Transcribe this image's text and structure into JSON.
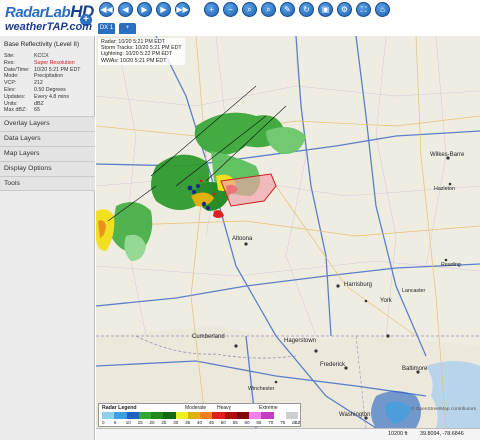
{
  "logo": {
    "line1": "RadarLab",
    "line1_hd": "HD",
    "plus": "+",
    "line2": "weatherTAP.com"
  },
  "toolbar": {
    "buttons": [
      {
        "icon": "skip-back-icon",
        "glyph": "◀◀"
      },
      {
        "icon": "step-back-icon",
        "glyph": "◀"
      },
      {
        "icon": "play-icon",
        "glyph": "▶"
      },
      {
        "icon": "step-forward-icon",
        "glyph": "▶"
      },
      {
        "icon": "skip-forward-icon",
        "glyph": "▶▶"
      },
      {
        "icon": "zoom-in-icon",
        "glyph": "+"
      },
      {
        "icon": "zoom-out-icon",
        "glyph": "−"
      },
      {
        "icon": "zoom-tool-icon",
        "glyph": "⌕"
      },
      {
        "icon": "zoom-reset-icon",
        "glyph": "⌕"
      },
      {
        "icon": "edit-icon",
        "glyph": "✎"
      },
      {
        "icon": "refresh-icon",
        "glyph": "↻"
      },
      {
        "icon": "save-icon",
        "glyph": "▣"
      },
      {
        "icon": "settings-icon",
        "glyph": "⚙"
      },
      {
        "icon": "fullscreen-icon",
        "glyph": "⛶"
      },
      {
        "icon": "home-icon",
        "glyph": "⌂"
      }
    ],
    "tabs": [
      {
        "label": "DX 1"
      },
      {
        "label": "+"
      }
    ]
  },
  "sidebar": {
    "title": "Base Reflectivity (Level II)",
    "info": [
      {
        "key": "Site:",
        "value": "KCCX"
      },
      {
        "key": "Res:",
        "value": "Super Resolution",
        "highlight": "#c81e1e"
      },
      {
        "key": "Date/Time:",
        "value": "10/20 5:21 PM EDT"
      },
      {
        "key": "Mode:",
        "value": "Precipitation"
      },
      {
        "key": "VCP:",
        "value": "212"
      },
      {
        "key": "Elev:",
        "value": "0.50 Degrees"
      },
      {
        "key": "Updates:",
        "value": "Every 4.8 mins"
      },
      {
        "key": "Units:",
        "value": "dBZ"
      },
      {
        "key": "Max dBZ:",
        "value": "65"
      }
    ],
    "menu": [
      "Overlay Layers",
      "Data Layers",
      "Map Layers",
      "Display Options",
      "Tools"
    ]
  },
  "map": {
    "overlay_info": [
      "Radar: 10/20 5:21 PM EDT",
      "Storm Tracks: 10/20 5:21 PM EDT",
      "Lightning: 10/20 5:22 PM EDT",
      "WWAs: 10/20 5:21 PM EDT"
    ],
    "cities": [
      {
        "name": "Wilkes-Barre",
        "big": true
      },
      {
        "name": "Hazleton",
        "big": false
      },
      {
        "name": "Altoona",
        "big": true
      },
      {
        "name": "Harrisburg",
        "big": true
      },
      {
        "name": "Reading",
        "big": false
      },
      {
        "name": "Lancaster",
        "big": false
      },
      {
        "name": "York",
        "big": true
      },
      {
        "name": "Cumberland",
        "big": true
      },
      {
        "name": "Hagerstown",
        "big": true
      },
      {
        "name": "Frederick",
        "big": true
      },
      {
        "name": "Winchester",
        "big": false
      },
      {
        "name": "Baltimore",
        "big": true
      },
      {
        "name": "Washington",
        "big": true
      }
    ],
    "legend": {
      "title": "Radar Legend",
      "categories": [
        "Moderate",
        "Heavy",
        "Extreme"
      ],
      "colors": [
        "#8fd0f0",
        "#3fa0e0",
        "#1f60c0",
        "#2faa2f",
        "#1f8a1f",
        "#106a10",
        "#f0f020",
        "#e0b010",
        "#f08020",
        "#e02020",
        "#b01010",
        "#800808",
        "#f080f0",
        "#c040c0",
        "#ffffff",
        "#cfcfcf"
      ],
      "ticks": [
        "0",
        "5",
        "10",
        "15",
        "20",
        "25",
        "30",
        "35",
        "40",
        "45",
        "50",
        "55",
        "60",
        "65",
        "70",
        "75",
        "dBZ"
      ]
    },
    "attribution": "© OpenStreetMap contributors"
  },
  "status": {
    "altitude": "10200 ft",
    "coords": "39.8094, -78.6846"
  }
}
